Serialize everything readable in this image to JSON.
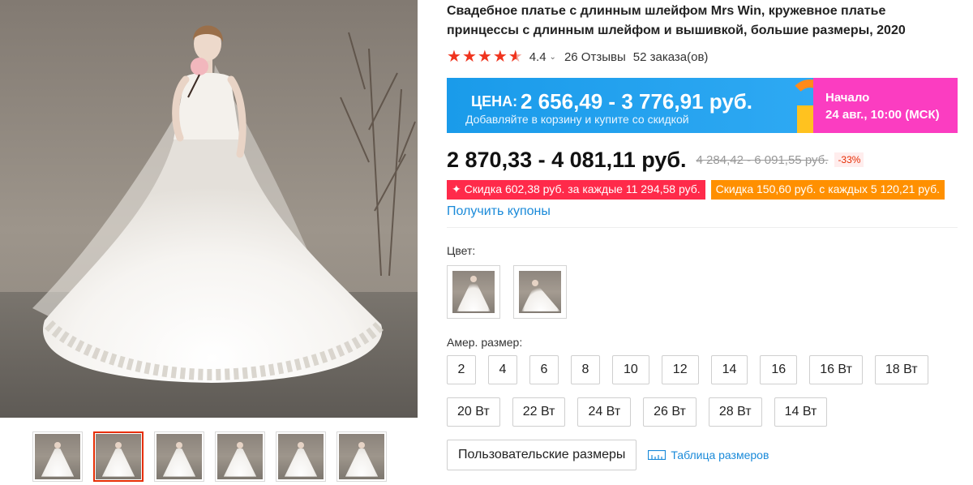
{
  "product": {
    "title": "Свадебное платье с длинным шлейфом Mrs Win, кружевное платье принцессы с длинным шлейфом и вышивкой, большие размеры, 2020",
    "rating": "4.4",
    "rating_caret": "⌄",
    "reviews": "26 Отзывы",
    "orders": "52 заказа(ов)",
    "stars": [
      "★",
      "★",
      "★",
      "★",
      "★"
    ]
  },
  "promo": {
    "price_label": "ЦЕНА:",
    "price": "2 656,49 - 3 776,91 руб.",
    "subtitle": "Добавляйте в корзину и купите со скидкой",
    "start_label": "Начало",
    "start_date": "24 авг., 10:00 (МСК)"
  },
  "price": {
    "current": "2 870,33 - 4 081,11 руб.",
    "old": "4 284,42 - 6 091,55 руб.",
    "discount": "-33%"
  },
  "coupons": {
    "store_coupon": "✦ Скидка 602,38 руб. за каждые 11 294,58 руб.",
    "seller_coupon": "Скидка 150,60 руб. с каждых 5 120,21 руб.",
    "get_coupons": "Получить купоны"
  },
  "color": {
    "label": "Цвет:"
  },
  "sizes": {
    "label": "Амер. размер:",
    "options": [
      "2",
      "4",
      "6",
      "8",
      "10",
      "12",
      "14",
      "16",
      "16 Вт",
      "18 Вт",
      "20 Вт",
      "22 Вт",
      "24 Вт",
      "26 Вт",
      "28 Вт",
      "14 Вт"
    ],
    "custom": "Пользовательские размеры",
    "size_chart": "Таблица размеров"
  },
  "colors": {
    "promo_blue": "#2aa6f1",
    "promo_pink": "#fb3dc1",
    "star_red": "#f0341e",
    "link_blue": "#1a8ad9",
    "coupon_red": "#ff2a4a",
    "coupon_orange": "#ff9000",
    "active_thumb": "#e62e04"
  }
}
